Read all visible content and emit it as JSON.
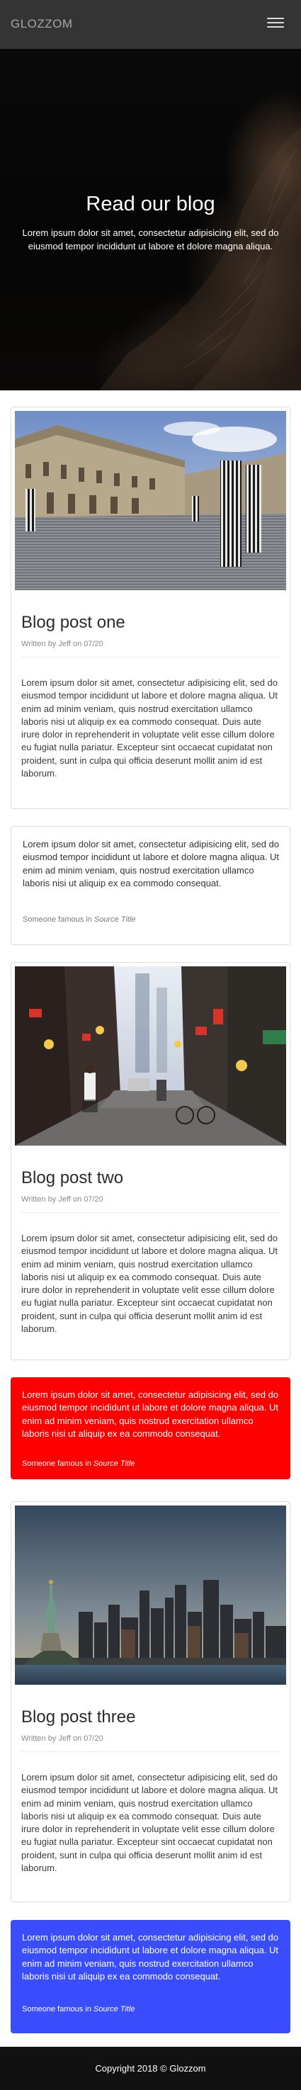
{
  "navbar": {
    "brand": "GLOZZOM",
    "menu_icon": "hamburger-menu-icon"
  },
  "hero": {
    "title": "Read our blog",
    "subtitle": "Lorem ipsum dolor sit amet, consectetur adipisicing elit, sed do eiusmod tempor incididunt ut labore et dolore magna aliqua."
  },
  "posts": [
    {
      "title": "Blog post one",
      "byline": "Written by Jeff on 07/20",
      "body": "Lorem ipsum dolor sit amet, consectetur adipisicing elit, sed do eiusmod tempor incididunt ut labore et dolore magna aliqua. Ut enim ad minim veniam, quis nostrud exercitation ullamco laboris nisi ut aliquip ex ea commodo consequat. Duis aute irure dolor in reprehenderit in voluptate velit esse cillum dolore eu fugiat nulla pariatur. Excepteur sint occaecat cupidatat non proident, sunt in culpa qui officia deserunt mollit anim id est laborum."
    },
    {
      "title": "Blog post two",
      "byline": "Written by Jeff on 07/20",
      "body": "Lorem ipsum dolor sit amet, consectetur adipisicing elit, sed do eiusmod tempor incididunt ut labore et dolore magna aliqua. Ut enim ad minim veniam, quis nostrud exercitation ullamco laboris nisi ut aliquip ex ea commodo consequat. Duis aute irure dolor in reprehenderit in voluptate velit esse cillum dolore eu fugiat nulla pariatur. Excepteur sint occaecat cupidatat non proident, sunt in culpa qui officia deserunt mollit anim id est laborum."
    },
    {
      "title": "Blog post three",
      "byline": "Written by Jeff on 07/20",
      "body": "Lorem ipsum dolor sit amet, consectetur adipisicing elit, sed do eiusmod tempor incididunt ut labore et dolore magna aliqua. Ut enim ad minim veniam, quis nostrud exercitation ullamco laboris nisi ut aliquip ex ea commodo consequat. Duis aute irure dolor in reprehenderit in voluptate velit esse cillum dolore eu fugiat nulla pariatur. Excepteur sint occaecat cupidatat non proident, sunt in culpa qui officia deserunt mollit anim id est laborum."
    }
  ],
  "quotes": [
    {
      "text": "Lorem ipsum dolor sit amet, consectetur adipisicing elit, sed do eiusmod tempor incididunt ut labore et dolore magna aliqua. Ut enim ad minim veniam, quis nostrud exercitation ullamco laboris nisi ut aliquip ex ea commodo consequat.",
      "attribution": "Someone famous in",
      "source": "Source Title",
      "color": "#ffffff"
    },
    {
      "text": "Lorem ipsum dolor sit amet, consectetur adipisicing elit, sed do eiusmod tempor incididunt ut labore et dolore magna aliqua. Ut enim ad minim veniam, quis nostrud exercitation ullamco laboris nisi ut aliquip ex ea commodo consequat.",
      "attribution": "Someone famous in",
      "source": "Source Title",
      "color": "#ff0000"
    },
    {
      "text": "Lorem ipsum dolor sit amet, consectetur adipisicing elit, sed do eiusmod tempor incididunt ut labore et dolore magna aliqua. Ut enim ad minim veniam, quis nostrud exercitation ullamco laboris nisi ut aliquip ex ea commodo consequat.",
      "attribution": "Someone famous in",
      "source": "Source Title",
      "color": "#3a4dfc"
    }
  ],
  "footer": {
    "text": "Copyright 2018 © Glozzom"
  }
}
